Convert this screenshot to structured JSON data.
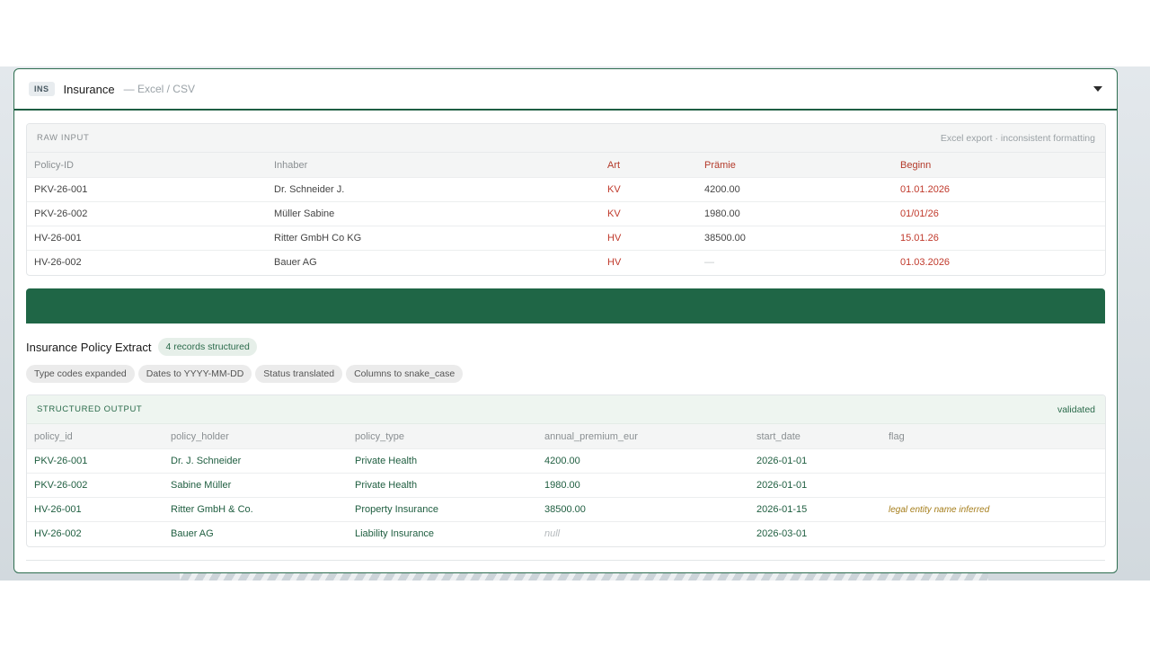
{
  "header": {
    "badge": "INS",
    "title": "Insurance",
    "subtitle": "— Excel / CSV"
  },
  "raw": {
    "label": "RAW INPUT",
    "note": "Excel export · inconsistent formatting",
    "columns": [
      "Policy-ID",
      "Inhaber",
      "Art",
      "Prämie",
      "Beginn"
    ],
    "rows": [
      [
        "PKV-26-001",
        "Dr. Schneider J.",
        "KV",
        "4200.00",
        "01.01.2026"
      ],
      [
        "PKV-26-002",
        "Müller Sabine",
        "KV",
        "1980.00",
        "01/01/26"
      ],
      [
        "HV-26-001",
        "Ritter GmbH Co KG",
        "HV",
        "38500.00",
        "15.01.26"
      ],
      [
        "HV-26-002",
        "Bauer AG",
        "HV",
        "—",
        "01.03.2026"
      ]
    ]
  },
  "extract": {
    "title": "Insurance Policy Extract",
    "count_badge": "4 records structured",
    "chips": [
      "Type codes expanded",
      "Dates to YYYY-MM-DD",
      "Status translated",
      "Columns to snake_case"
    ]
  },
  "output": {
    "label": "STRUCTURED OUTPUT",
    "status": "validated",
    "columns": [
      "policy_id",
      "policy_holder",
      "policy_type",
      "annual_premium_eur",
      "start_date",
      "flag"
    ],
    "rows": [
      [
        "PKV-26-001",
        "Dr. J. Schneider",
        "Private Health",
        "4200.00",
        "2026-01-01",
        ""
      ],
      [
        "PKV-26-002",
        "Sabine Müller",
        "Private Health",
        "1980.00",
        "2026-01-01",
        ""
      ],
      [
        "HV-26-001",
        "Ritter GmbH & Co.",
        "Property Insurance",
        "38500.00",
        "2026-01-15",
        "legal entity name inferred"
      ],
      [
        "HV-26-002",
        "Bauer AG",
        "Liability Insurance",
        "null",
        "2026-03-01",
        ""
      ]
    ]
  }
}
